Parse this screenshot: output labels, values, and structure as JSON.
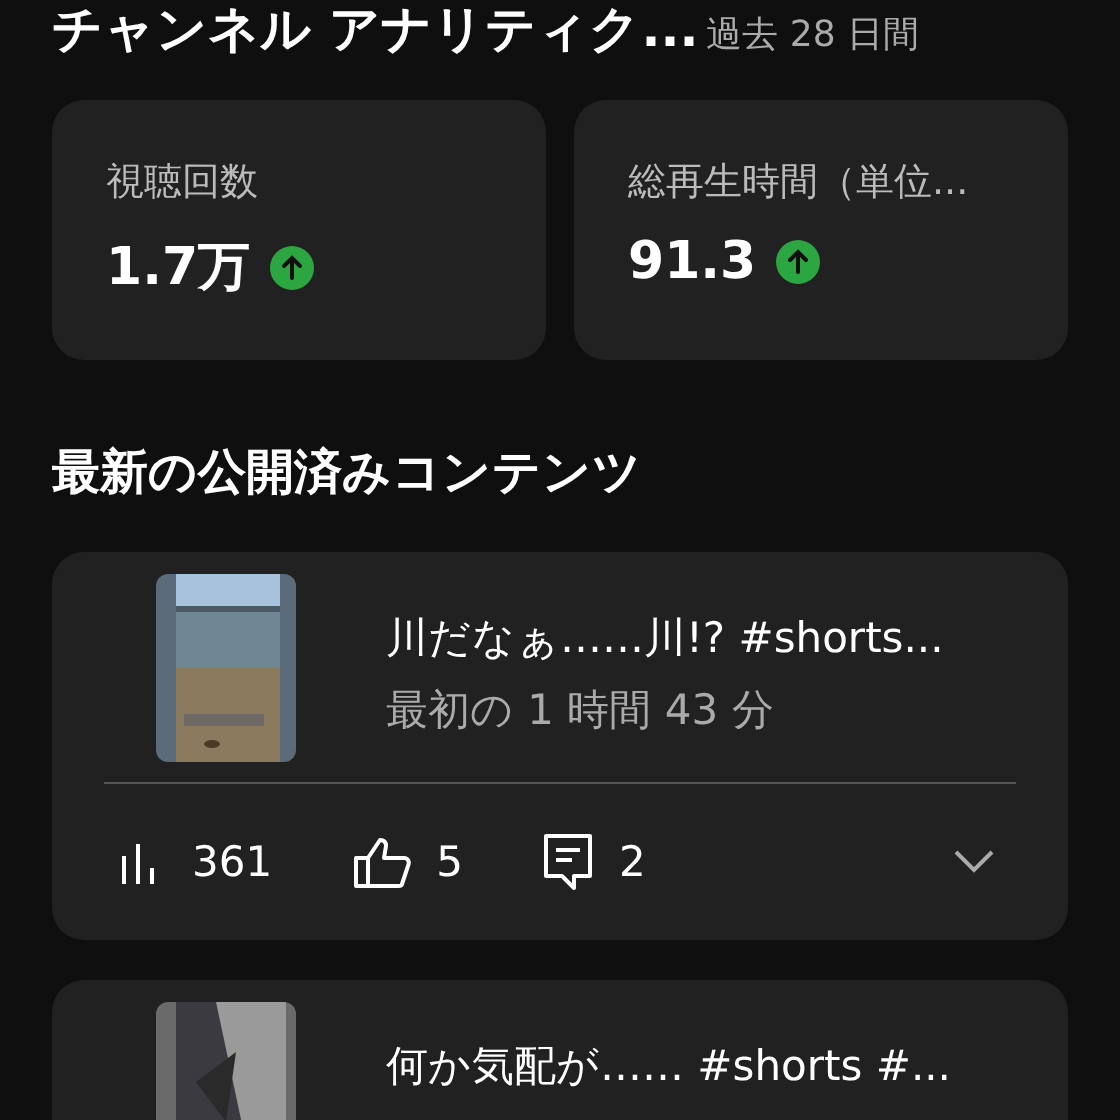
{
  "header": {
    "title": "チャンネル アナリティク...",
    "period": "過去 28 日間"
  },
  "metrics": [
    {
      "label": "視聴回数",
      "value": "1.7万",
      "rising": true
    },
    {
      "label": "総再生時間（単位...",
      "value": "91.3",
      "rising": true
    }
  ],
  "section_title": "最新の公開済みコンテンツ",
  "videos": [
    {
      "title": "川だなぁ……川!? #shorts...",
      "subtitle": "最初の 1 時間 43 分",
      "stats": {
        "views": "361",
        "likes": "5",
        "comments": "2"
      },
      "expanded": false
    },
    {
      "title": "何か気配が…… #shorts #..."
    }
  ]
}
